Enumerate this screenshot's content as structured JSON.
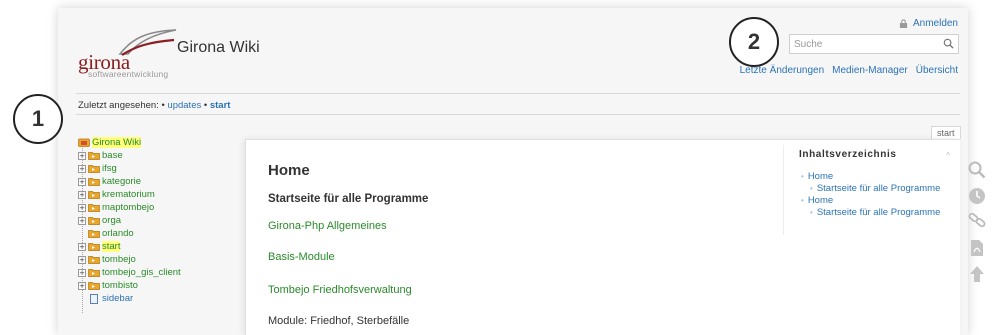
{
  "header": {
    "logo_word": "girona",
    "logo_sub": "softwareentwicklung",
    "site_title": "Girona Wiki",
    "login_label": "Anmelden",
    "search_placeholder": "Suche",
    "nav": [
      "Letzte Änderungen",
      "Medien-Manager",
      "Übersicht"
    ]
  },
  "trace": {
    "label": "Zuletzt angesehen:",
    "items": [
      "updates",
      "start"
    ]
  },
  "badges": [
    "1",
    "2"
  ],
  "tree": {
    "root": "Girona Wiki",
    "items": [
      {
        "label": "base",
        "expandable": true,
        "highlight": false
      },
      {
        "label": "ifsg",
        "expandable": true,
        "highlight": false
      },
      {
        "label": "kategorie",
        "expandable": true,
        "highlight": false
      },
      {
        "label": "krematorium",
        "expandable": true,
        "highlight": false
      },
      {
        "label": "maptombejo",
        "expandable": true,
        "highlight": false
      },
      {
        "label": "orga",
        "expandable": true,
        "highlight": false
      },
      {
        "label": "orlando",
        "expandable": false,
        "highlight": false
      },
      {
        "label": "start",
        "expandable": true,
        "highlight": true
      },
      {
        "label": "tombejo",
        "expandable": true,
        "highlight": false
      },
      {
        "label": "tombejo_gis_client",
        "expandable": true,
        "highlight": false
      },
      {
        "label": "tombisto",
        "expandable": true,
        "highlight": false
      }
    ],
    "page": "sidebar"
  },
  "content": {
    "tab": "start",
    "h1": "Home",
    "h2": "Startseite für alle Programme",
    "links": [
      "Girona-Php Allgemeines",
      "Basis-Module",
      "Tombejo Friedhofsverwaltung"
    ],
    "text": "Module: Friedhof, Sterbefälle"
  },
  "toc": {
    "title": "Inhaltsverzeichnis",
    "collapse": "^",
    "rows": [
      {
        "label": "Home",
        "sub": false
      },
      {
        "label": "Startseite für alle Programme",
        "sub": true
      },
      {
        "label": "Home",
        "sub": false
      },
      {
        "label": "Startseite für alle Programme",
        "sub": true
      }
    ]
  },
  "tools": [
    "search-icon",
    "history-icon",
    "backlink-icon",
    "pdf-icon",
    "back-to-top-icon"
  ],
  "colors": {
    "brand": "#8a1f23",
    "link": "#2b73b7",
    "wikilink": "#2a8a2a",
    "highlight": "#ffff7a"
  }
}
